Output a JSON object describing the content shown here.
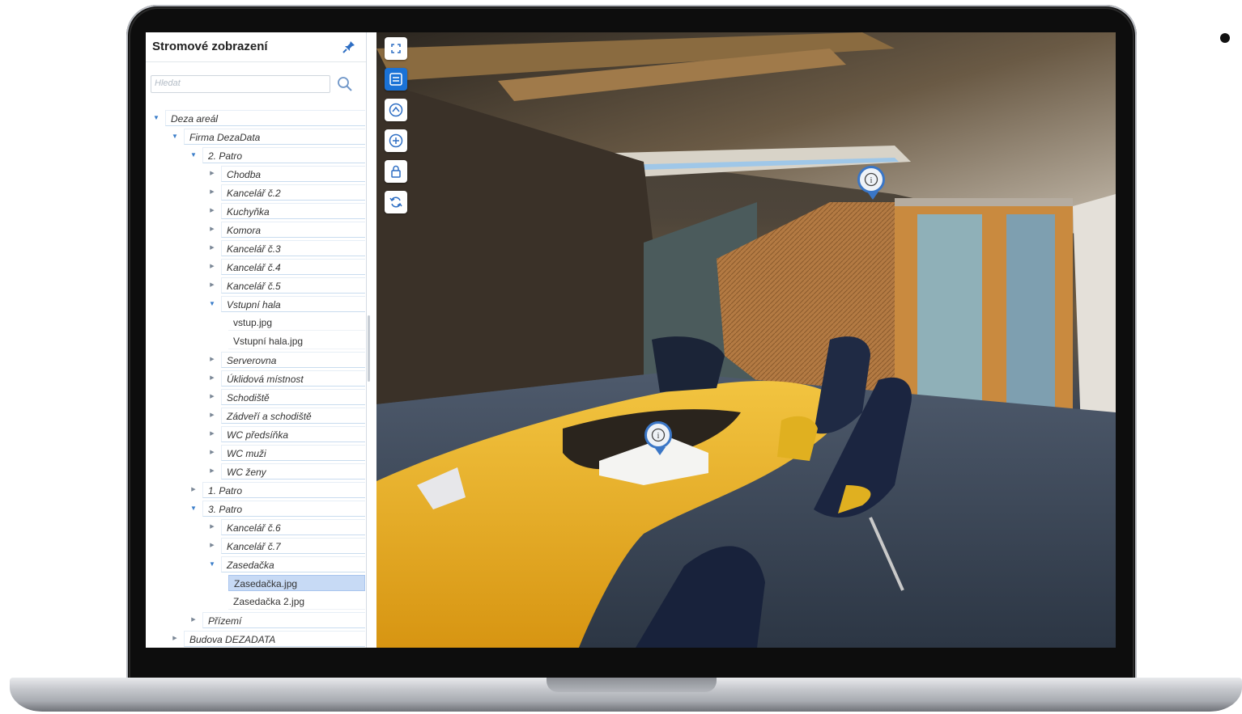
{
  "sidebar": {
    "title": "Stromové zobrazení",
    "search_placeholder": "Hledat",
    "tree": [
      {
        "label": "Deza areál",
        "depth": 0,
        "state": "expanded",
        "type": "folder"
      },
      {
        "label": "Firma DezaData",
        "depth": 1,
        "state": "expanded",
        "type": "folder"
      },
      {
        "label": "2. Patro",
        "depth": 2,
        "state": "expanded",
        "type": "folder"
      },
      {
        "label": "Chodba",
        "depth": 3,
        "state": "collapsed",
        "type": "folder"
      },
      {
        "label": "Kancelář č.2",
        "depth": 3,
        "state": "collapsed",
        "type": "folder"
      },
      {
        "label": "Kuchyňka",
        "depth": 3,
        "state": "collapsed",
        "type": "folder"
      },
      {
        "label": "Komora",
        "depth": 3,
        "state": "collapsed",
        "type": "folder"
      },
      {
        "label": "Kancelář č.3",
        "depth": 3,
        "state": "collapsed",
        "type": "folder"
      },
      {
        "label": "Kancelář č.4",
        "depth": 3,
        "state": "collapsed",
        "type": "folder"
      },
      {
        "label": "Kancelář č.5",
        "depth": 3,
        "state": "collapsed",
        "type": "folder"
      },
      {
        "label": "Vstupní hala",
        "depth": 3,
        "state": "expanded",
        "type": "folder"
      },
      {
        "label": "vstup.jpg",
        "depth": 4,
        "type": "file"
      },
      {
        "label": "Vstupní hala.jpg",
        "depth": 4,
        "type": "file"
      },
      {
        "label": "Serverovna",
        "depth": 3,
        "state": "collapsed",
        "type": "folder"
      },
      {
        "label": "Úklidová místnost",
        "depth": 3,
        "state": "collapsed",
        "type": "folder"
      },
      {
        "label": "Schodiště",
        "depth": 3,
        "state": "collapsed",
        "type": "folder"
      },
      {
        "label": "Zádveří a schodiště",
        "depth": 3,
        "state": "collapsed",
        "type": "folder"
      },
      {
        "label": "WC předsíňka",
        "depth": 3,
        "state": "collapsed",
        "type": "folder"
      },
      {
        "label": "WC muži",
        "depth": 3,
        "state": "collapsed",
        "type": "folder"
      },
      {
        "label": "WC ženy",
        "depth": 3,
        "state": "collapsed",
        "type": "folder"
      },
      {
        "label": "1. Patro",
        "depth": 2,
        "state": "collapsed",
        "type": "folder"
      },
      {
        "label": "3. Patro",
        "depth": 2,
        "state": "expanded",
        "type": "folder"
      },
      {
        "label": "Kancelář č.6",
        "depth": 3,
        "state": "collapsed",
        "type": "folder"
      },
      {
        "label": "Kancelář č.7",
        "depth": 3,
        "state": "collapsed",
        "type": "folder"
      },
      {
        "label": "Zasedačka",
        "depth": 3,
        "state": "expanded",
        "type": "folder"
      },
      {
        "label": "Zasedačka.jpg",
        "depth": 4,
        "type": "file",
        "selected": true
      },
      {
        "label": "Zasedačka 2.jpg",
        "depth": 4,
        "type": "file"
      },
      {
        "label": "Přízemí",
        "depth": 2,
        "state": "collapsed",
        "type": "folder"
      },
      {
        "label": "Budova DEZADATA",
        "depth": 1,
        "state": "collapsed",
        "type": "folder"
      }
    ]
  },
  "viewer": {
    "toolbar": [
      {
        "name": "fullscreen-button",
        "icon": "fullscreen-icon",
        "active": false
      },
      {
        "name": "tree-toggle-button",
        "icon": "list-panel-icon",
        "active": true
      },
      {
        "name": "compass-button",
        "icon": "compass-icon",
        "active": false
      },
      {
        "name": "zoom-in-button",
        "icon": "zoom-in-icon",
        "active": false
      },
      {
        "name": "lock-button",
        "icon": "lock-icon",
        "active": false
      },
      {
        "name": "rotate-button",
        "icon": "rotate-icon",
        "active": false
      }
    ],
    "hotspots": [
      {
        "name": "info-hotspot-door",
        "icon": "info-icon"
      },
      {
        "name": "info-hotspot-table",
        "icon": "info-icon"
      }
    ]
  },
  "colors": {
    "accent": "#1a72d6",
    "tree_border": "#c9dcef",
    "selected": "#c7daf5"
  }
}
